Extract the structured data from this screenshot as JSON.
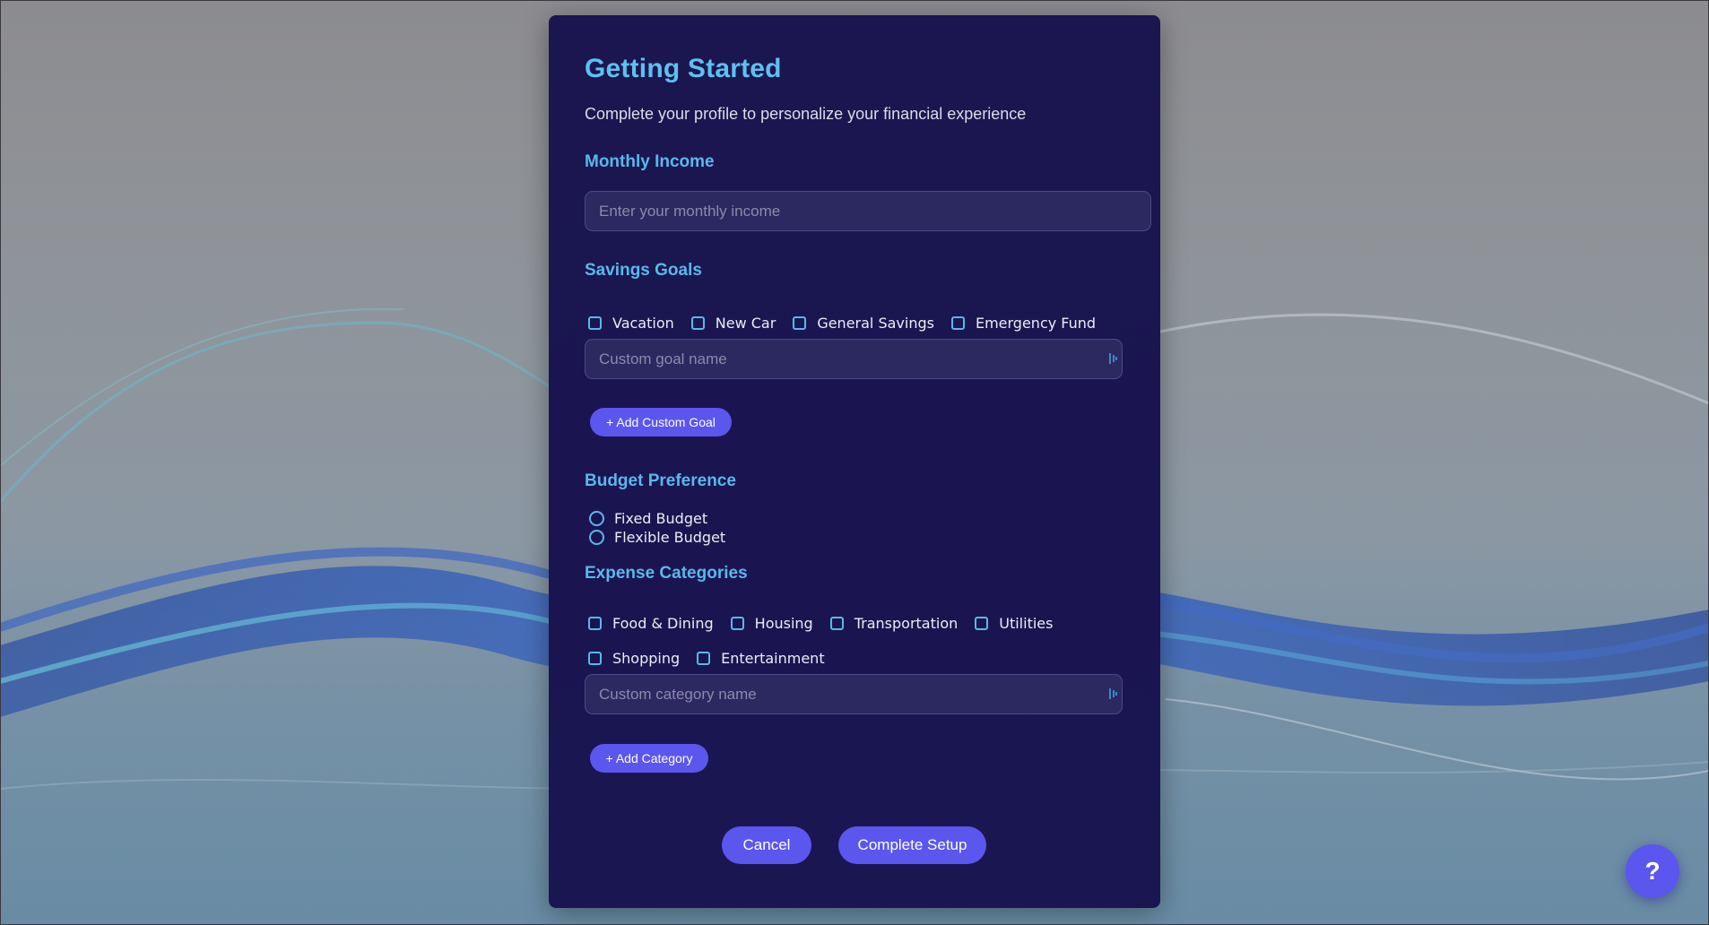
{
  "header": {
    "title": "Getting Started",
    "subtitle": "Complete your profile to personalize your financial experience"
  },
  "income": {
    "label": "Monthly Income",
    "placeholder": "Enter your monthly income",
    "value": ""
  },
  "savings": {
    "label": "Savings Goals",
    "options": [
      "Vacation",
      "New Car",
      "General Savings",
      "Emergency Fund"
    ],
    "custom_placeholder": "Custom goal name",
    "add_button": "+ Add Custom Goal"
  },
  "budget": {
    "label": "Budget Preference",
    "options": [
      "Fixed Budget",
      "Flexible Budget"
    ]
  },
  "expenses": {
    "label": "Expense Categories",
    "options": [
      "Food & Dining",
      "Housing",
      "Transportation",
      "Utilities",
      "Shopping",
      "Entertainment"
    ],
    "custom_placeholder": "Custom category name",
    "add_button": "+ Add Category"
  },
  "actions": {
    "cancel": "Cancel",
    "complete": "Complete Setup"
  },
  "help": {
    "label": "?"
  },
  "icons": {
    "input_grip": "grip-icon",
    "help": "help-icon"
  },
  "colors": {
    "accent": "#5b56ee",
    "heading": "#5ec0ef",
    "panel": "#1b1650",
    "input_bg": "#2c2860"
  }
}
